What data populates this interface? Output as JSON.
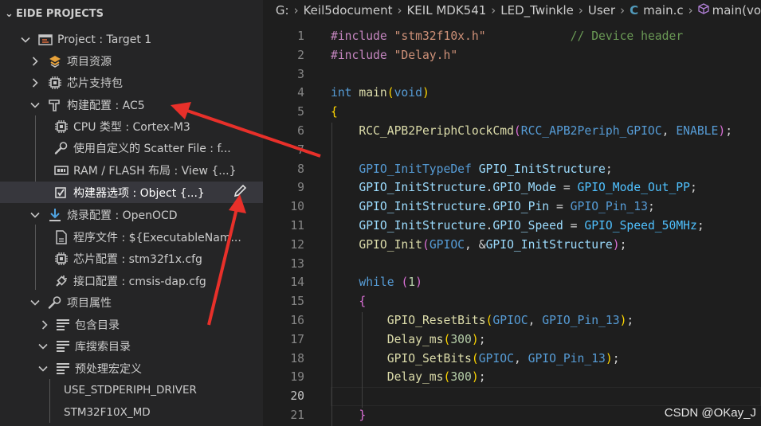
{
  "sidebar": {
    "title": "EIDE PROJECTS",
    "rows": [
      {
        "label": "Project : Target 1"
      },
      {
        "label": "项目资源"
      },
      {
        "label": "芯片支持包"
      },
      {
        "label": "构建配置 : AC5"
      },
      {
        "label": "CPU 类型 : Cortex-M3"
      },
      {
        "label": "使用自定义的 Scatter File : f..."
      },
      {
        "label": "RAM / FLASH 布局 : View {...}"
      },
      {
        "label": "构建器选项 : Object {...}"
      },
      {
        "label": "烧录配置 : OpenOCD"
      },
      {
        "label": "程序文件 : ${ExecutableNam..."
      },
      {
        "label": "芯片配置 : stm32f1x.cfg"
      },
      {
        "label": "接口配置 : cmsis-dap.cfg"
      },
      {
        "label": "项目属性"
      },
      {
        "label": "包含目录"
      },
      {
        "label": "库搜索目录"
      },
      {
        "label": "预处理宏定义"
      },
      {
        "label": "USE_STDPERIPH_DRIVER"
      },
      {
        "label": "STM32F10X_MD"
      }
    ]
  },
  "breadcrumb": [
    "G:",
    "Keil5document",
    "KEIL MDK541",
    "LED_Twinkle",
    "User",
    "main.c",
    "main(vo"
  ],
  "breadcrumb_file_icon": "C",
  "editor": {
    "current_line": 20,
    "lines": [
      {
        "n": "1",
        "t": [
          [
            "pp",
            "#include "
          ],
          [
            "str",
            "\"stm32f10x.h\""
          ],
          [
            "cm",
            "            // Device header"
          ]
        ]
      },
      {
        "n": "2",
        "t": [
          [
            "pp",
            "#include "
          ],
          [
            "str",
            "\"Delay.h\""
          ]
        ]
      },
      {
        "n": "3",
        "t": []
      },
      {
        "n": "4",
        "t": [
          [
            "ty",
            "int "
          ],
          [
            "fn",
            "main"
          ],
          [
            "br",
            "("
          ],
          [
            "ty",
            "void"
          ],
          [
            "br",
            ")"
          ]
        ]
      },
      {
        "n": "5",
        "t": [
          [
            "br",
            "{"
          ]
        ]
      },
      {
        "n": "6",
        "t": [
          [
            "pun",
            "    "
          ],
          [
            "fn",
            "RCC_APB2PeriphClockCmd"
          ],
          [
            "br2",
            "("
          ],
          [
            "mac",
            "RCC_APB2Periph_GPIOC"
          ],
          [
            "pun",
            ", "
          ],
          [
            "mac",
            "ENABLE"
          ],
          [
            "br2",
            ")"
          ],
          [
            "pun",
            ";"
          ]
        ]
      },
      {
        "n": "7",
        "t": []
      },
      {
        "n": "8",
        "t": [
          [
            "pun",
            "    "
          ],
          [
            "ty",
            "GPIO_InitTypeDef "
          ],
          [
            "var",
            "GPIO_InitStructure"
          ],
          [
            "pun",
            ";"
          ]
        ]
      },
      {
        "n": "9",
        "t": [
          [
            "pun",
            "    "
          ],
          [
            "var",
            "GPIO_InitStructure"
          ],
          [
            "pun",
            "."
          ],
          [
            "var",
            "GPIO_Mode"
          ],
          [
            "pun",
            " = "
          ],
          [
            "en",
            "GPIO_Mode_Out_PP"
          ],
          [
            "pun",
            ";"
          ]
        ]
      },
      {
        "n": "10",
        "t": [
          [
            "pun",
            "    "
          ],
          [
            "var",
            "GPIO_InitStructure"
          ],
          [
            "pun",
            "."
          ],
          [
            "var",
            "GPIO_Pin"
          ],
          [
            "pun",
            " = "
          ],
          [
            "mac",
            "GPIO_Pin_13"
          ],
          [
            "pun",
            ";"
          ]
        ]
      },
      {
        "n": "11",
        "t": [
          [
            "pun",
            "    "
          ],
          [
            "var",
            "GPIO_InitStructure"
          ],
          [
            "pun",
            "."
          ],
          [
            "var",
            "GPIO_Speed"
          ],
          [
            "pun",
            " = "
          ],
          [
            "en",
            "GPIO_Speed_50MHz"
          ],
          [
            "pun",
            ";"
          ]
        ]
      },
      {
        "n": "12",
        "t": [
          [
            "pun",
            "    "
          ],
          [
            "fn",
            "GPIO_Init"
          ],
          [
            "br2",
            "("
          ],
          [
            "mac",
            "GPIOC"
          ],
          [
            "pun",
            ", &"
          ],
          [
            "var",
            "GPIO_InitStructure"
          ],
          [
            "br2",
            ")"
          ],
          [
            "pun",
            ";"
          ]
        ]
      },
      {
        "n": "13",
        "t": []
      },
      {
        "n": "14",
        "t": [
          [
            "pun",
            "    "
          ],
          [
            "kw",
            "while "
          ],
          [
            "br2",
            "("
          ],
          [
            "num",
            "1"
          ],
          [
            "br2",
            ")"
          ]
        ]
      },
      {
        "n": "15",
        "t": [
          [
            "pun",
            "    "
          ],
          [
            "br2",
            "{"
          ]
        ]
      },
      {
        "n": "16",
        "t": [
          [
            "pun",
            "        "
          ],
          [
            "fn",
            "GPIO_ResetBits"
          ],
          [
            "br",
            "("
          ],
          [
            "mac",
            "GPIOC"
          ],
          [
            "pun",
            ", "
          ],
          [
            "mac",
            "GPIO_Pin_13"
          ],
          [
            "br",
            ")"
          ],
          [
            "pun",
            ";"
          ]
        ]
      },
      {
        "n": "17",
        "t": [
          [
            "pun",
            "        "
          ],
          [
            "fn",
            "Delay_ms"
          ],
          [
            "br",
            "("
          ],
          [
            "num",
            "300"
          ],
          [
            "br",
            ")"
          ],
          [
            "pun",
            ";"
          ]
        ]
      },
      {
        "n": "18",
        "t": [
          [
            "pun",
            "        "
          ],
          [
            "fn",
            "GPIO_SetBits"
          ],
          [
            "br",
            "("
          ],
          [
            "mac",
            "GPIOC"
          ],
          [
            "pun",
            ", "
          ],
          [
            "mac",
            "GPIO_Pin_13"
          ],
          [
            "br",
            ")"
          ],
          [
            "pun",
            ";"
          ]
        ]
      },
      {
        "n": "19",
        "t": [
          [
            "pun",
            "        "
          ],
          [
            "fn",
            "Delay_ms"
          ],
          [
            "br",
            "("
          ],
          [
            "num",
            "300"
          ],
          [
            "br",
            ")"
          ],
          [
            "pun",
            ";"
          ]
        ]
      },
      {
        "n": "20",
        "t": []
      },
      {
        "n": "21",
        "t": [
          [
            "pun",
            "    "
          ],
          [
            "br2",
            "}"
          ]
        ]
      }
    ]
  },
  "watermark": "CSDN @OKay_J",
  "colors": {
    "sidebar_bg": "#252526",
    "editor_bg": "#1e1e1e",
    "arrow": "#e8302a",
    "selected_row": "#37373d"
  },
  "icons": [
    "chevron-down-icon",
    "chevron-right-icon",
    "project-icon",
    "package-icon",
    "chip-icon",
    "hammer-icon",
    "wrench-icon",
    "memory-icon",
    "options-icon",
    "download-icon",
    "file-icon",
    "plug-icon",
    "list-icon",
    "pencil-icon",
    "c-file-icon",
    "cube-icon"
  ]
}
